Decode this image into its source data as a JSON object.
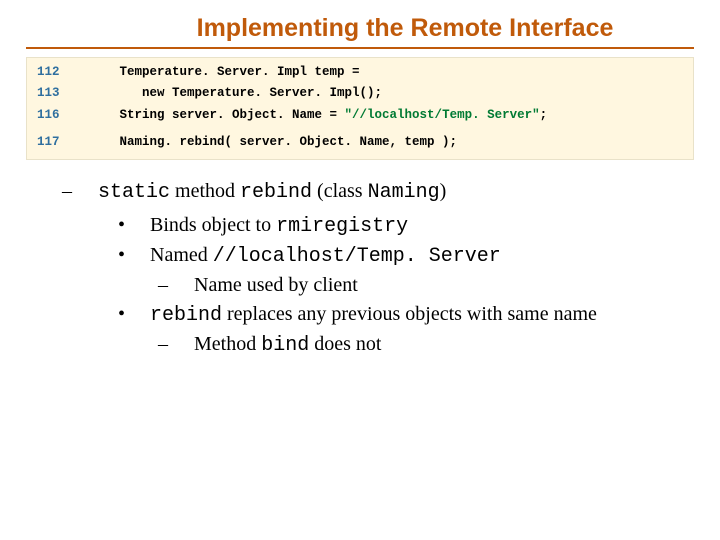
{
  "title": "Implementing the Remote Interface",
  "code": {
    "lines": [
      {
        "num": "112",
        "text": "   Temperature. Server. Impl temp ="
      },
      {
        "num": "113",
        "text": "      new Temperature. Server. Impl();"
      },
      {
        "num": "116",
        "text_pre": "   String server. Object. Name = ",
        "str": "\"//localhost/Temp. Server\"",
        "text_post": ";"
      }
    ],
    "after_gap": [
      {
        "num": "117",
        "text": "   Naming. rebind( server. Object. Name, temp );"
      }
    ]
  },
  "bullets": {
    "l1_parts": [
      "static",
      " method ",
      "rebind",
      " (class ",
      "Naming",
      ")"
    ],
    "l2a_parts": [
      "Binds object to ",
      "rmiregistry"
    ],
    "l2b_parts": [
      "Named ",
      "//localhost/Temp. Server"
    ],
    "l3a": "Name used by client",
    "l2c_parts": [
      "rebind",
      " replaces any previous objects with same name"
    ],
    "l3b_parts": [
      "Method ",
      "bind",
      " does not"
    ]
  }
}
